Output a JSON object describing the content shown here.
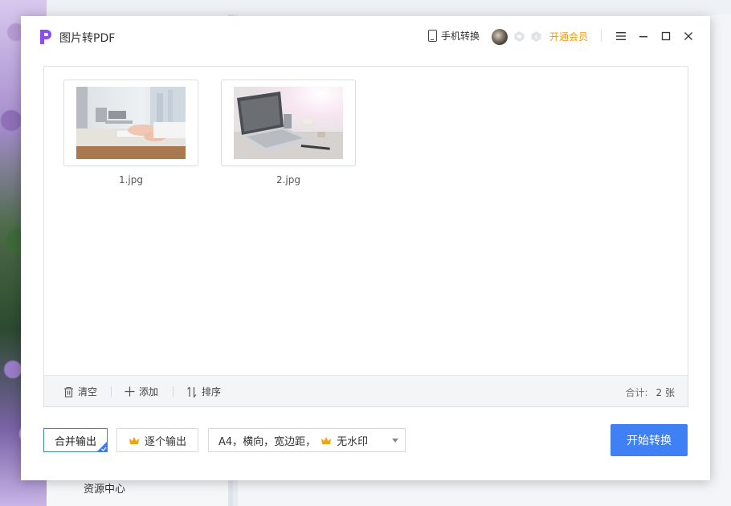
{
  "background": {
    "sidebar_item": "资源中心"
  },
  "dialog": {
    "title": "图片转PDF",
    "logo_icon": "pdf-app-logo",
    "mobile_convert": "手机转换",
    "vip_link": "开通会员",
    "accent_color": "#3f80f5",
    "vip_color": "#f29b0b"
  },
  "files": [
    {
      "name": "1.jpg",
      "thumbnail": "desk-typing-photo"
    },
    {
      "name": "2.jpg",
      "thumbnail": "laptop-desk-photo"
    }
  ],
  "toolbar": {
    "clear": "清空",
    "add": "添加",
    "sort": "排序",
    "total_label": "合计:",
    "total_value": "2 张"
  },
  "options": {
    "merge_output": "合并输出",
    "single_output": "逐个输出",
    "page_setting": "A4，横向，宽边距，",
    "watermark": "无水印",
    "selected": "merge_output"
  },
  "start_button": "开始转换"
}
